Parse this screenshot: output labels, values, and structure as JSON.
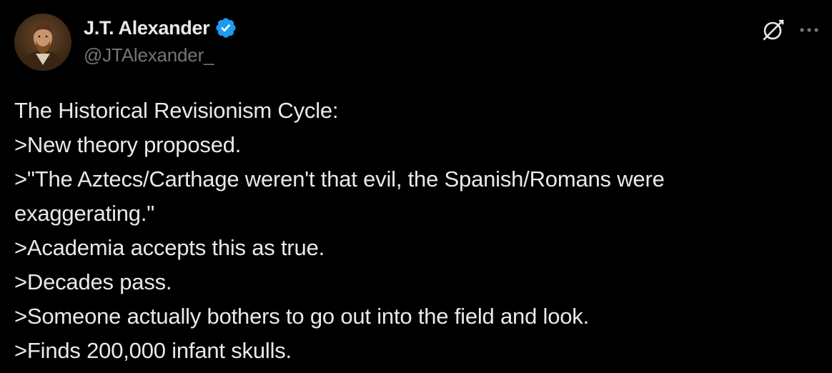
{
  "author": {
    "display_name": "J.T. Alexander",
    "handle": "@JTAlexander_",
    "verified": true,
    "avatar_icon": "portrait-avatar"
  },
  "actions": {
    "grok_icon": "grok-icon",
    "more_icon": "more-options-icon"
  },
  "tweet": {
    "lines": [
      "The Historical Revisionism Cycle:",
      ">New theory proposed.",
      ">\"The Aztecs/Carthage weren't that evil, the Spanish/Romans were",
      "exaggerating.\"",
      ">Academia accepts this as true.",
      ">Decades pass.",
      ">Someone actually bothers to go out into the field and look.",
      ">Finds 200,000 infant skulls."
    ]
  },
  "colors": {
    "background": "#000000",
    "text_primary": "#e7e9ea",
    "text_secondary": "#71767b",
    "verified_badge": "#1d9bf0"
  }
}
